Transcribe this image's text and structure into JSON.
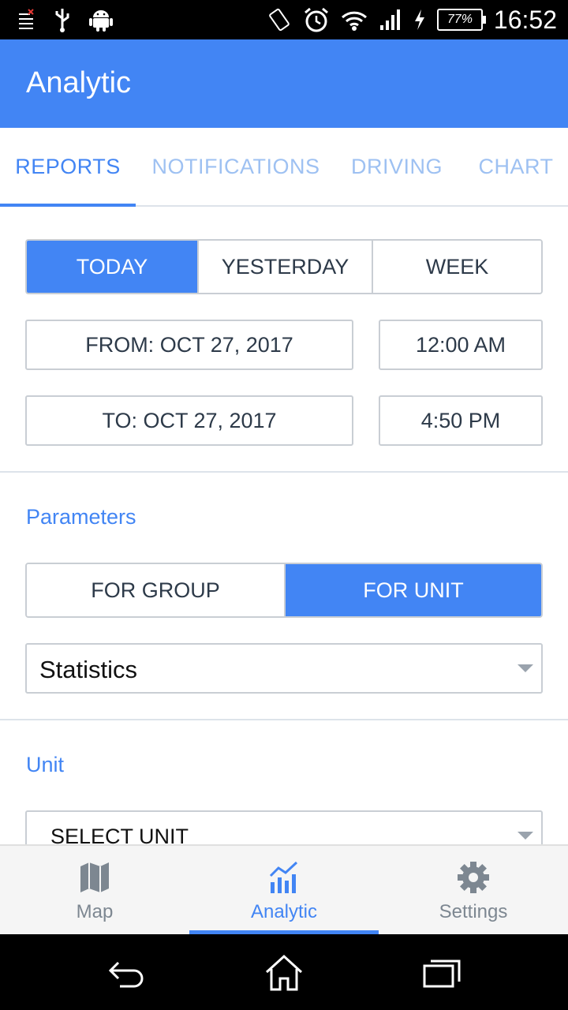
{
  "status_bar": {
    "time": "16:52",
    "battery": "77%",
    "icons": [
      "notification-list-icon",
      "usb-icon",
      "android-icon",
      "rotate-icon",
      "alarm-icon",
      "wifi-icon",
      "signal-icon",
      "charging-icon"
    ]
  },
  "app_bar": {
    "title": "Analytic"
  },
  "tabs": [
    {
      "label": "REPORTS",
      "active": true
    },
    {
      "label": "NOTIFICATIONS",
      "active": false
    },
    {
      "label": "DRIVING",
      "active": false
    },
    {
      "label": "CHART",
      "active": false
    }
  ],
  "period": {
    "options": [
      "TODAY",
      "YESTERDAY",
      "WEEK"
    ],
    "selected": "TODAY"
  },
  "range": {
    "from_date": "FROM: OCT 27, 2017",
    "from_time": "12:00 AM",
    "to_date": "TO: OCT 27, 2017",
    "to_time": "4:50 PM"
  },
  "parameters": {
    "title": "Parameters",
    "scope_options": [
      "FOR GROUP",
      "FOR UNIT"
    ],
    "scope_selected": "FOR UNIT",
    "report_type": "Statistics"
  },
  "unit": {
    "title": "Unit",
    "value": "SELECT UNIT"
  },
  "bottom_nav": [
    {
      "label": "Map",
      "icon": "map-icon",
      "active": false
    },
    {
      "label": "Analytic",
      "icon": "bar-chart-icon",
      "active": true
    },
    {
      "label": "Settings",
      "icon": "gear-icon",
      "active": false
    }
  ],
  "colors": {
    "accent": "#4285f4",
    "tab_inactive": "#9ec1f2",
    "text": "#2d3a49",
    "border": "#c9ced4"
  }
}
